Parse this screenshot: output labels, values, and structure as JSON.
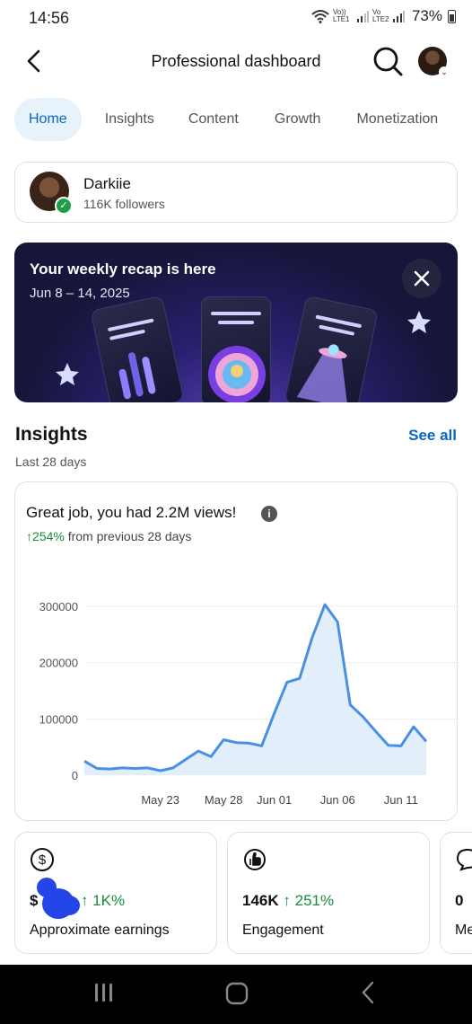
{
  "status_bar": {
    "time": "14:56",
    "net1": "Vo)) LTE1",
    "net2": "Vo LTE2",
    "battery": "73%"
  },
  "header": {
    "title": "Professional dashboard",
    "back_icon": "back-arrow-icon",
    "search_icon": "search-icon"
  },
  "tabs": [
    {
      "label": "Home",
      "active": true
    },
    {
      "label": "Insights",
      "active": false
    },
    {
      "label": "Content",
      "active": false
    },
    {
      "label": "Growth",
      "active": false
    },
    {
      "label": "Monetization",
      "active": false
    }
  ],
  "profile": {
    "name": "Darkiie",
    "followers": "116K followers"
  },
  "recap": {
    "title": "Your weekly recap is here",
    "dates": "Jun 8 – 14, 2025"
  },
  "insights": {
    "title": "Insights",
    "see_all": "See all",
    "period": "Last 28 days",
    "headline": "Great job, you had 2.2M views!",
    "change_arrow": "↑",
    "change_value": "254%",
    "change_text": " from previous 28 days"
  },
  "chart_data": {
    "type": "area",
    "y_ticks": [
      "300000",
      "200000",
      "100000",
      "0"
    ],
    "x_ticks": [
      "May 23",
      "May 28",
      "Jun 01",
      "Jun 06",
      "Jun 11"
    ],
    "ylim": [
      0,
      320000
    ],
    "grid": true,
    "line_color": "#4a90e2",
    "fill_color": "#e3eefb",
    "values": [
      25000,
      12000,
      11000,
      13000,
      12000,
      13000,
      8000,
      13000,
      28000,
      43000,
      33000,
      63000,
      58000,
      57000,
      52000,
      110000,
      165000,
      172000,
      245000,
      303000,
      272000,
      125000,
      104000,
      78000,
      53000,
      52000,
      86000,
      60000
    ]
  },
  "metrics": [
    {
      "icon": "dollar-circle-icon",
      "value_prefix": "$",
      "change": "1K%",
      "label": "Approximate earnings"
    },
    {
      "icon": "engagement-icon",
      "value": "146K",
      "change": "251%",
      "label": "Engagement"
    },
    {
      "icon": "comment-icon",
      "value": "0",
      "change": "",
      "label": "Me"
    }
  ],
  "nav": {
    "recent": "recent-apps-icon",
    "home": "home-icon",
    "back": "back-icon"
  }
}
